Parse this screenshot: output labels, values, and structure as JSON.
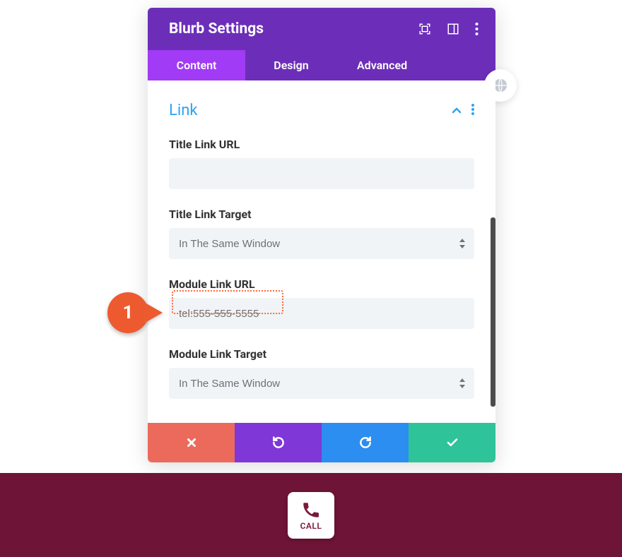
{
  "header": {
    "title": "Blurb Settings"
  },
  "tabs": {
    "content": "Content",
    "design": "Design",
    "advanced": "Advanced"
  },
  "section": {
    "title": "Link"
  },
  "fields": {
    "title_link_url": {
      "label": "Title Link URL",
      "value": ""
    },
    "title_link_target": {
      "label": "Title Link Target",
      "value": "In The Same Window"
    },
    "module_link_url": {
      "label": "Module Link URL",
      "value": "tel:555-555-5555"
    },
    "module_link_target": {
      "label": "Module Link Target",
      "value": "In The Same Window"
    }
  },
  "callout": {
    "number": "1"
  },
  "bottom": {
    "call_label": "CALL"
  }
}
